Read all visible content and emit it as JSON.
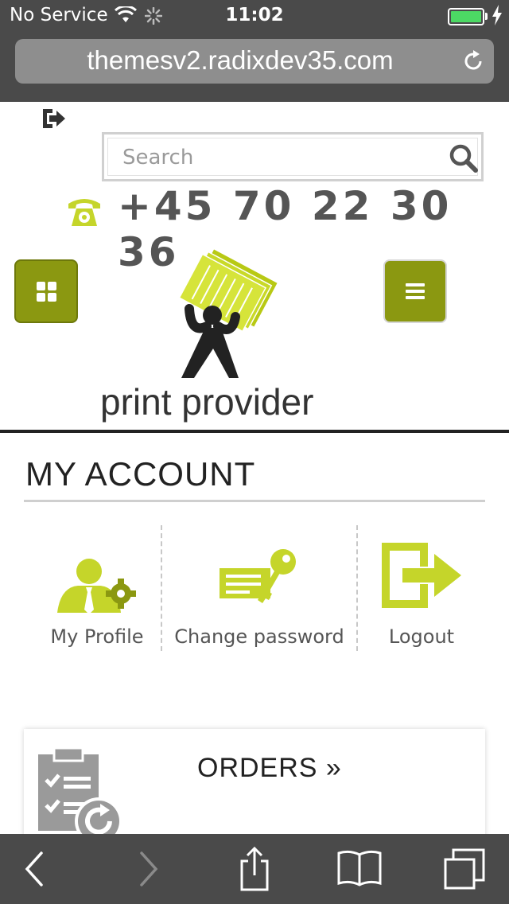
{
  "status_bar": {
    "carrier": "No Service",
    "time": "11:02",
    "battery_level": 1.0
  },
  "browser": {
    "url": "themesv2.radixdev35.com"
  },
  "header": {
    "search_placeholder": "Search",
    "phone": "+45 70 22 30 36",
    "logo_text": "print provider"
  },
  "account": {
    "title": "MY ACCOUNT",
    "items": [
      {
        "label": "My Profile",
        "icon": "profile-settings-icon"
      },
      {
        "label": "Change password",
        "icon": "password-key-icon"
      },
      {
        "label": "Logout",
        "icon": "logout-icon"
      }
    ]
  },
  "orders": {
    "label": "ORDERS »",
    "icon": "orders-clipboard-icon"
  },
  "toolbar": {
    "icons": [
      "back-icon",
      "forward-icon",
      "share-icon",
      "bookmarks-icon",
      "tabs-icon"
    ]
  },
  "colors": {
    "accent": "#8b9811",
    "icon_green": "#c5d52a",
    "chrome": "#4a4a4a"
  }
}
